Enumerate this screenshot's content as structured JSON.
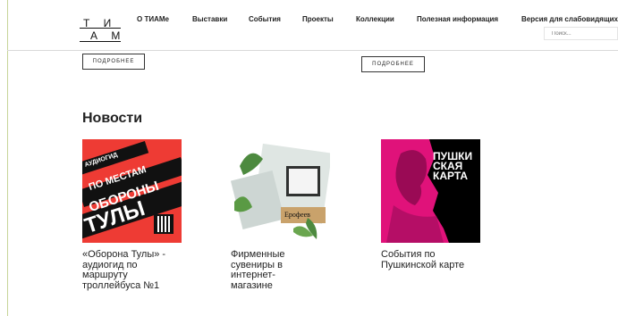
{
  "header": {
    "logo": {
      "row1": "Т И",
      "row2": "А М"
    },
    "nav": [
      "О ТИАМе",
      "Выставки",
      "События",
      "Проекты",
      "Коллекции",
      "Полезная информация",
      "Версия для слабовидящих"
    ],
    "search_placeholder": "Поиск..."
  },
  "buttons": {
    "more_left": "ПОДРОБНЕЕ",
    "more_right": "ПОДРОБНЕЕ"
  },
  "news": {
    "title": "Новости",
    "items": [
      {
        "caption_lines": [
          "«Оборона Тулы» -",
          "аудиогид по",
          "маршруту",
          "троллейбуса №1"
        ],
        "image_text": [
          "АУДИОГИД",
          "ПО МЕСТАМ",
          "ОБОРОНЫ",
          "ТУЛЫ"
        ],
        "image_bg": "#ee3b34"
      },
      {
        "caption_lines": [
          "Фирменные",
          "сувениры в",
          "интернет-",
          "магазине"
        ],
        "image_text": [
          "Ерофеев"
        ],
        "image_bg": "#ffffff"
      },
      {
        "caption_lines": [
          "События по",
          "Пушкинской карте"
        ],
        "image_text": [
          "ПУШКИ",
          "СКАЯ",
          "КАРТА"
        ],
        "image_bg": "#000000"
      }
    ]
  },
  "colors": {
    "accent_red": "#ee3b34",
    "pink": "#e0127a",
    "left_rule": "#c8d59a"
  }
}
